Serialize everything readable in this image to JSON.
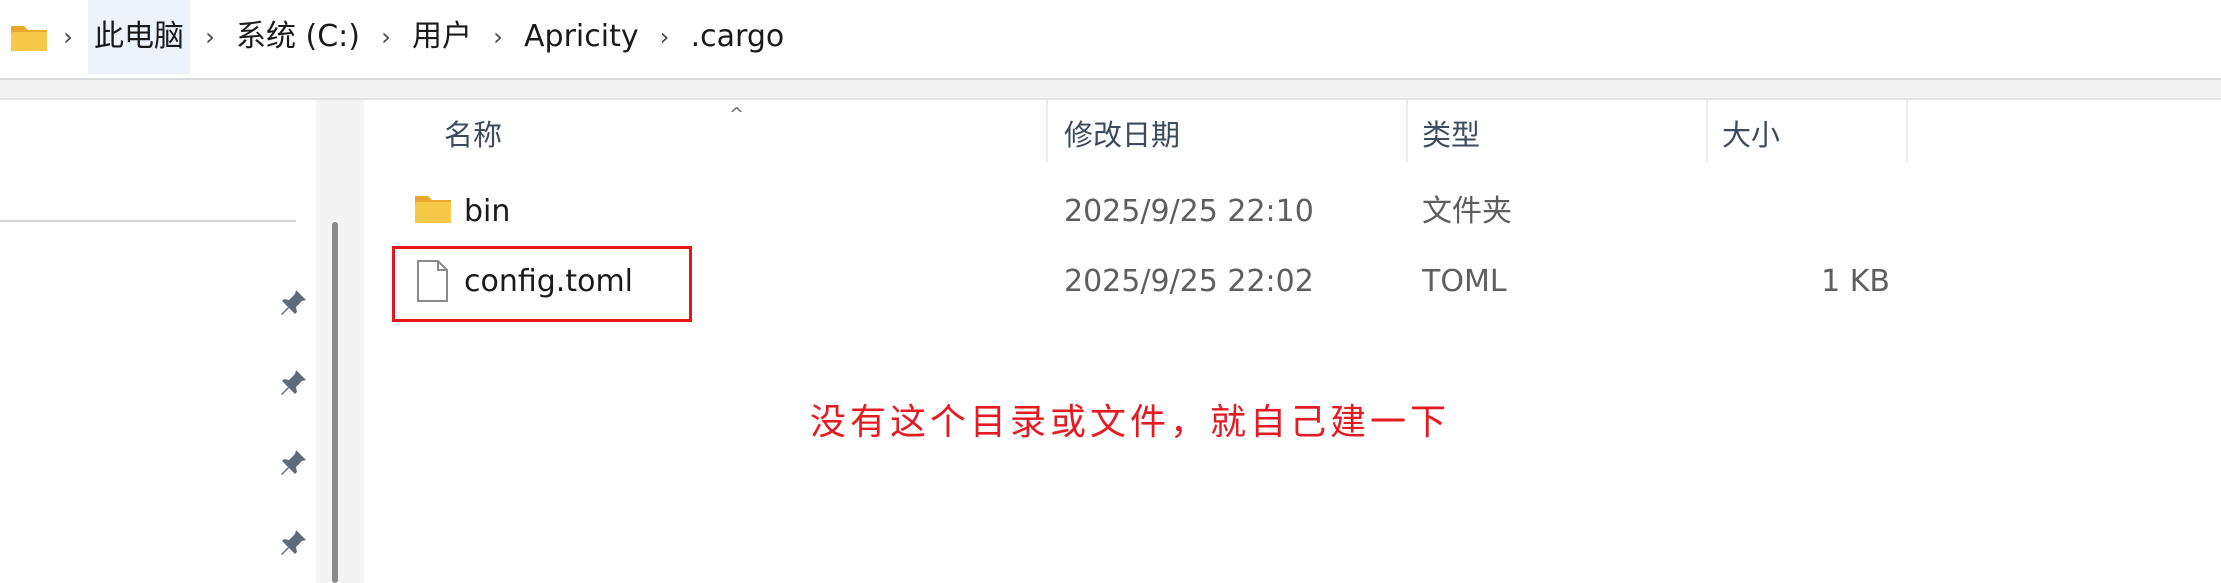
{
  "breadcrumb": [
    "此电脑",
    "系统 (C:)",
    "用户",
    "Apricity",
    ".cargo"
  ],
  "columns": {
    "name": "名称",
    "modified": "修改日期",
    "type": "类型",
    "size": "大小"
  },
  "files": [
    {
      "name": "bin",
      "modified": "2025/9/25 22:10",
      "type": "文件夹",
      "size": "",
      "icon": "folder-icon"
    },
    {
      "name": "config.toml",
      "modified": "2025/9/25 22:02",
      "type": "TOML",
      "size": "1 KB",
      "icon": "file-icon"
    }
  ],
  "annotation": "没有这个目录或文件，就自己建一下",
  "colors": {
    "annotation": "#e31b23",
    "highlight_box": "#e8141b",
    "folder": "#f2c14e",
    "breadcrumb_highlight": "#edf3fb"
  },
  "nav": {
    "pinned_items": 4
  }
}
